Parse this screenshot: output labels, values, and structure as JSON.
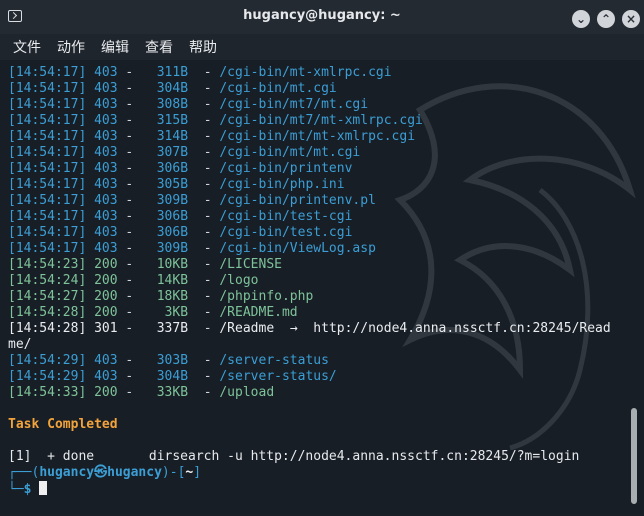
{
  "window": {
    "title": "hugancy@hugancy: ~",
    "min_icon": "minimize-icon",
    "max_icon": "maximize-icon",
    "close_icon": "close-icon"
  },
  "menu": {
    "file": "文件",
    "action": "动作",
    "edit": "编辑",
    "view": "查看",
    "help": "帮助"
  },
  "output": [
    {
      "time": "[14:54:17]",
      "status": "403",
      "size": "311B",
      "path": "/cgi-bin/mt-xmlrpc.cgi",
      "kind": "403"
    },
    {
      "time": "[14:54:17]",
      "status": "403",
      "size": "304B",
      "path": "/cgi-bin/mt.cgi",
      "kind": "403"
    },
    {
      "time": "[14:54:17]",
      "status": "403",
      "size": "308B",
      "path": "/cgi-bin/mt7/mt.cgi",
      "kind": "403"
    },
    {
      "time": "[14:54:17]",
      "status": "403",
      "size": "315B",
      "path": "/cgi-bin/mt7/mt-xmlrpc.cgi",
      "kind": "403"
    },
    {
      "time": "[14:54:17]",
      "status": "403",
      "size": "314B",
      "path": "/cgi-bin/mt/mt-xmlrpc.cgi",
      "kind": "403"
    },
    {
      "time": "[14:54:17]",
      "status": "403",
      "size": "307B",
      "path": "/cgi-bin/mt/mt.cgi",
      "kind": "403"
    },
    {
      "time": "[14:54:17]",
      "status": "403",
      "size": "306B",
      "path": "/cgi-bin/printenv",
      "kind": "403"
    },
    {
      "time": "[14:54:17]",
      "status": "403",
      "size": "305B",
      "path": "/cgi-bin/php.ini",
      "kind": "403"
    },
    {
      "time": "[14:54:17]",
      "status": "403",
      "size": "309B",
      "path": "/cgi-bin/printenv.pl",
      "kind": "403"
    },
    {
      "time": "[14:54:17]",
      "status": "403",
      "size": "306B",
      "path": "/cgi-bin/test-cgi",
      "kind": "403"
    },
    {
      "time": "[14:54:17]",
      "status": "403",
      "size": "306B",
      "path": "/cgi-bin/test.cgi",
      "kind": "403"
    },
    {
      "time": "[14:54:17]",
      "status": "403",
      "size": "309B",
      "path": "/cgi-bin/ViewLog.asp",
      "kind": "403"
    },
    {
      "time": "[14:54:23]",
      "status": "200",
      "size": "10KB",
      "path": "/LICENSE",
      "kind": "200"
    },
    {
      "time": "[14:54:24]",
      "status": "200",
      "size": "14KB",
      "path": "/logo",
      "kind": "200"
    },
    {
      "time": "[14:54:27]",
      "status": "200",
      "size": "18KB",
      "path": "/phpinfo.php",
      "kind": "200"
    },
    {
      "time": "[14:54:28]",
      "status": "200",
      "size": "3KB",
      "path": "/README.md",
      "kind": "200"
    },
    {
      "time": "[14:54:28]",
      "status": "301",
      "size": "337B",
      "path": "/Readme",
      "redirect": "http://node4.anna.nssctf.cn:28245/Read",
      "kind": "301"
    },
    {
      "text": "me/",
      "kind": "plain"
    },
    {
      "time": "[14:54:29]",
      "status": "403",
      "size": "303B",
      "path": "/server-status",
      "kind": "403"
    },
    {
      "time": "[14:54:29]",
      "status": "403",
      "size": "304B",
      "path": "/server-status/",
      "kind": "403"
    },
    {
      "time": "[14:54:33]",
      "status": "200",
      "size": "33KB",
      "path": "/upload",
      "kind": "200"
    }
  ],
  "task_completed": "Task Completed",
  "job_line": "[1]  + done       dirsearch -u http://node4.anna.nssctf.cn:28245/?m=login",
  "prompt": {
    "user": "hugancy",
    "at_symbol": "㉿",
    "host": "hugancy",
    "cwd": "~",
    "dollar": "$"
  },
  "colors": {
    "forbidden": "#3b9ed5",
    "ok": "#7ec39a",
    "task": "#f3a33b"
  }
}
